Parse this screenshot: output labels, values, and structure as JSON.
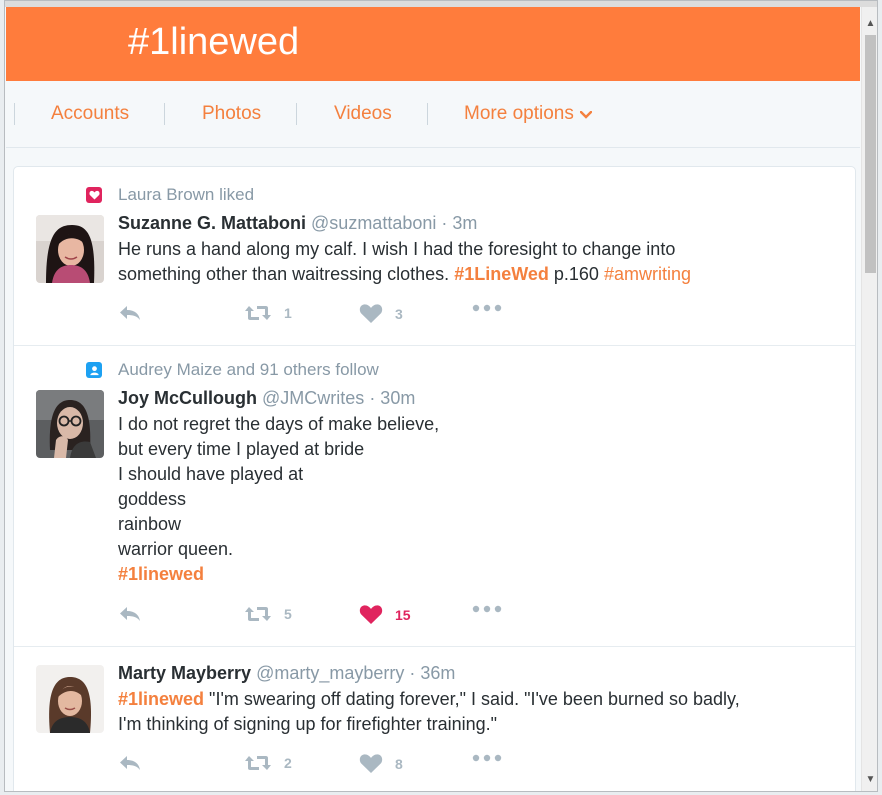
{
  "header": {
    "title": "#1linewed"
  },
  "nav": {
    "items": [
      "Accounts",
      "Photos",
      "Videos",
      "More options"
    ]
  },
  "colors": {
    "accent": "#ff7c3c",
    "link": "#f4803e",
    "like": "#e0245e",
    "follow": "#1da1f2"
  },
  "tweets": [
    {
      "context_icon": "heart-badge-icon",
      "context": "Laura Brown liked",
      "name": "Suzanne G. Mattaboni",
      "handle": "@suzmattaboni",
      "time": "· 3m",
      "text_a": "He runs a hand along my calf. I wish I had the foresight to change into\nsomething other than waitressing clothes. ",
      "tag1": "#1LineWed",
      "text_b": " p.160 ",
      "tag2": "#amwriting",
      "retweets": "1",
      "likes": "3",
      "liked": false
    },
    {
      "context_icon": "person-badge-icon",
      "context": "Audrey Maize and 91 others follow",
      "name": "Joy McCullough",
      "handle": "@JMCwrites",
      "time": "· 30m",
      "text_a": "I do not regret the days of make believe,\nbut every time I played at bride\nI should have played at\ngoddess\nrainbow\nwarrior queen.",
      "tag1": "#1linewed",
      "retweets": "5",
      "likes": "15",
      "liked": true
    },
    {
      "name": "Marty Mayberry",
      "handle": "@marty_mayberry",
      "time": "· 36m",
      "tag1": "#1linewed",
      "text_a": " \"I'm swearing off dating forever,\" I said. \"I've been burned so badly,\nI'm thinking of signing up for firefighter training.\"",
      "retweets": "2",
      "likes": "8",
      "liked": false
    }
  ]
}
